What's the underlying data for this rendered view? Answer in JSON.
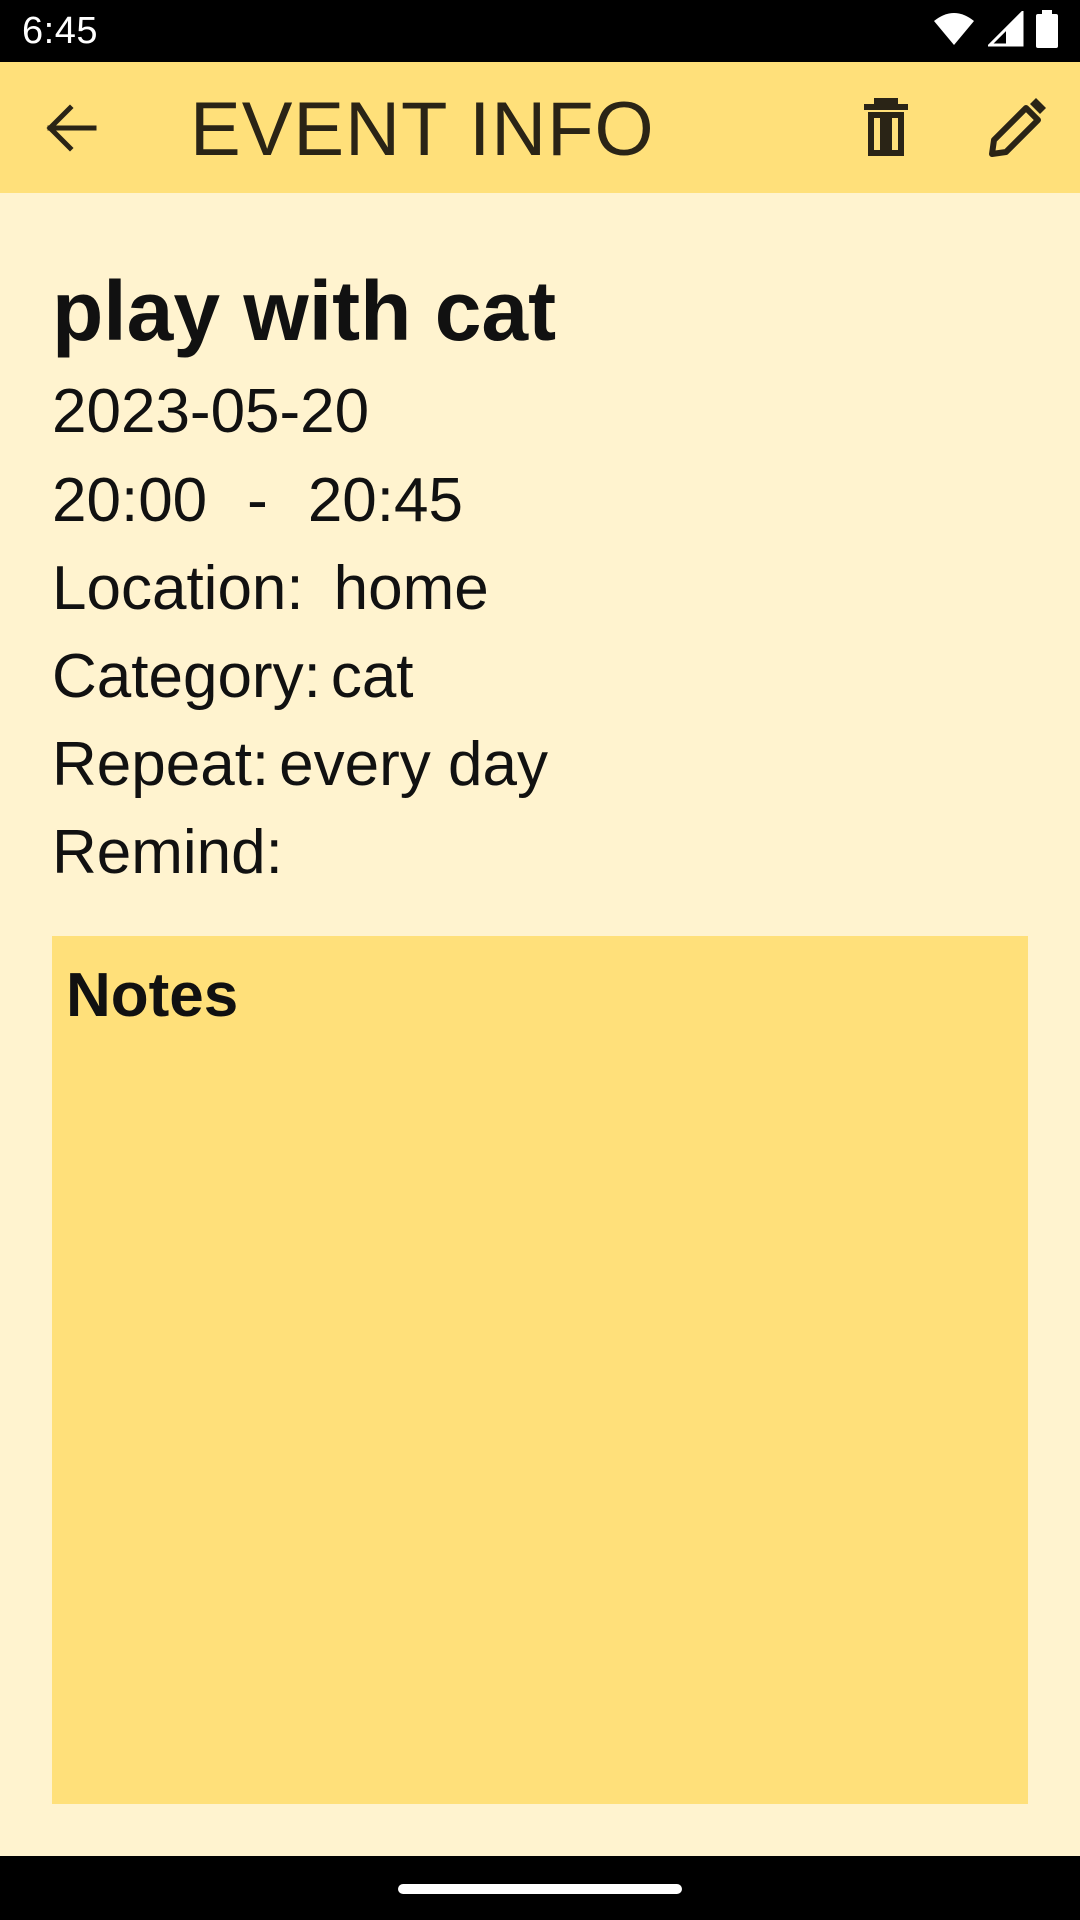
{
  "status_bar": {
    "time": "6:45",
    "icons": [
      "wifi-icon",
      "cellular-icon",
      "battery-icon"
    ]
  },
  "app_bar": {
    "title": "EVENT INFO",
    "back_icon": "arrow-left-icon",
    "delete_icon": "trash-icon",
    "edit_icon": "pencil-icon",
    "background": "#FFE07A"
  },
  "event": {
    "title": "play with cat",
    "date": "2023-05-20",
    "start_time": "20:00",
    "time_separator": "-",
    "end_time": "20:45",
    "location_label": "Location:",
    "location_value": "home",
    "category_label": "Category:",
    "category_value": "cat",
    "repeat_label": "Repeat:",
    "repeat_value": "every day",
    "remind_label": "Remind:",
    "remind_value": ""
  },
  "notes": {
    "label": "Notes",
    "content": ""
  },
  "colors": {
    "page_background": "#FFF3CF",
    "accent": "#FFE07A"
  }
}
